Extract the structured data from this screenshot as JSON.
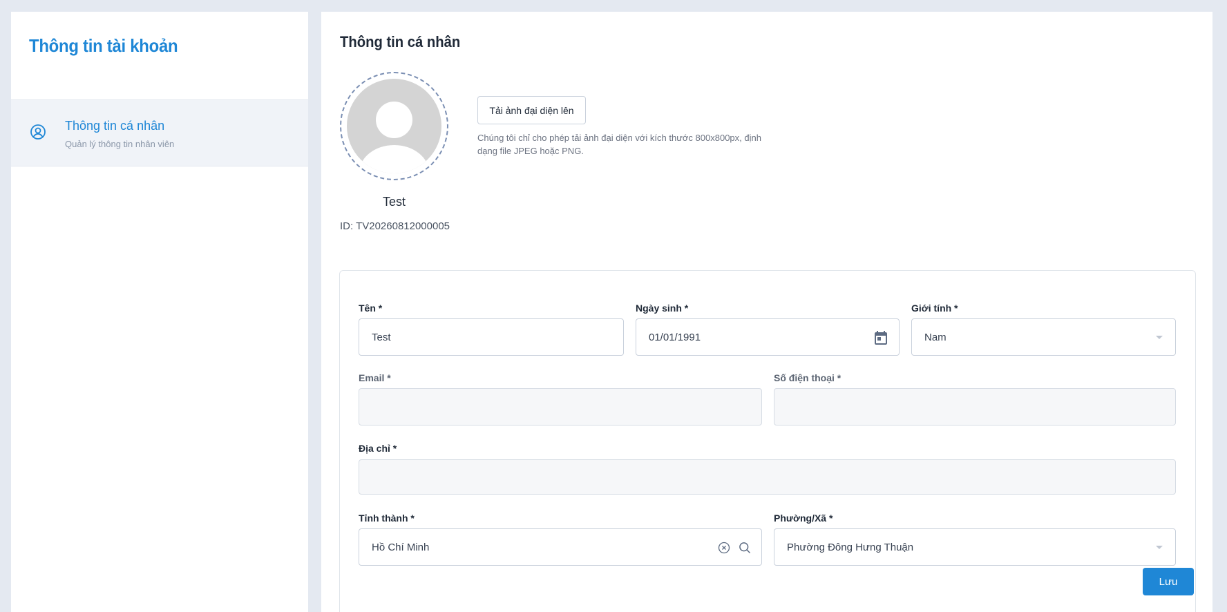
{
  "sidebar": {
    "title": "Thông tin tài khoản",
    "items": [
      {
        "label": "Thông tin cá nhân",
        "description": "Quản lý thông tin nhân viên",
        "icon": "user-circle-icon",
        "active": true
      }
    ]
  },
  "main": {
    "title": "Thông tin cá nhân",
    "profile": {
      "name": "Test",
      "id_text": "ID: TV20260812000005"
    },
    "upload": {
      "button_label": "Tải ảnh đại diện lên",
      "note": "Chúng tôi chỉ cho phép tải ảnh đại diện với kích thước 800x800px, định dạng file JPEG hoặc PNG."
    },
    "form": {
      "name": {
        "label": "Tên *",
        "value": "Test"
      },
      "dob": {
        "label": "Ngày sinh *",
        "value": "01/01/1991"
      },
      "gender": {
        "label": "Giới tính *",
        "value": "Nam"
      },
      "email": {
        "label": "Email *",
        "value": ""
      },
      "phone": {
        "label": "Số điện thoại *",
        "value": ""
      },
      "address": {
        "label": "Địa chỉ *",
        "value": ""
      },
      "province": {
        "label": "Tỉnh thành *",
        "value": "Hồ Chí Minh"
      },
      "ward": {
        "label": "Phường/Xã *",
        "value": "Phường Đông Hưng Thuận"
      },
      "save_label": "Lưu"
    }
  },
  "colors": {
    "accent": "#1f87d6",
    "background": "#e4e9f1"
  }
}
